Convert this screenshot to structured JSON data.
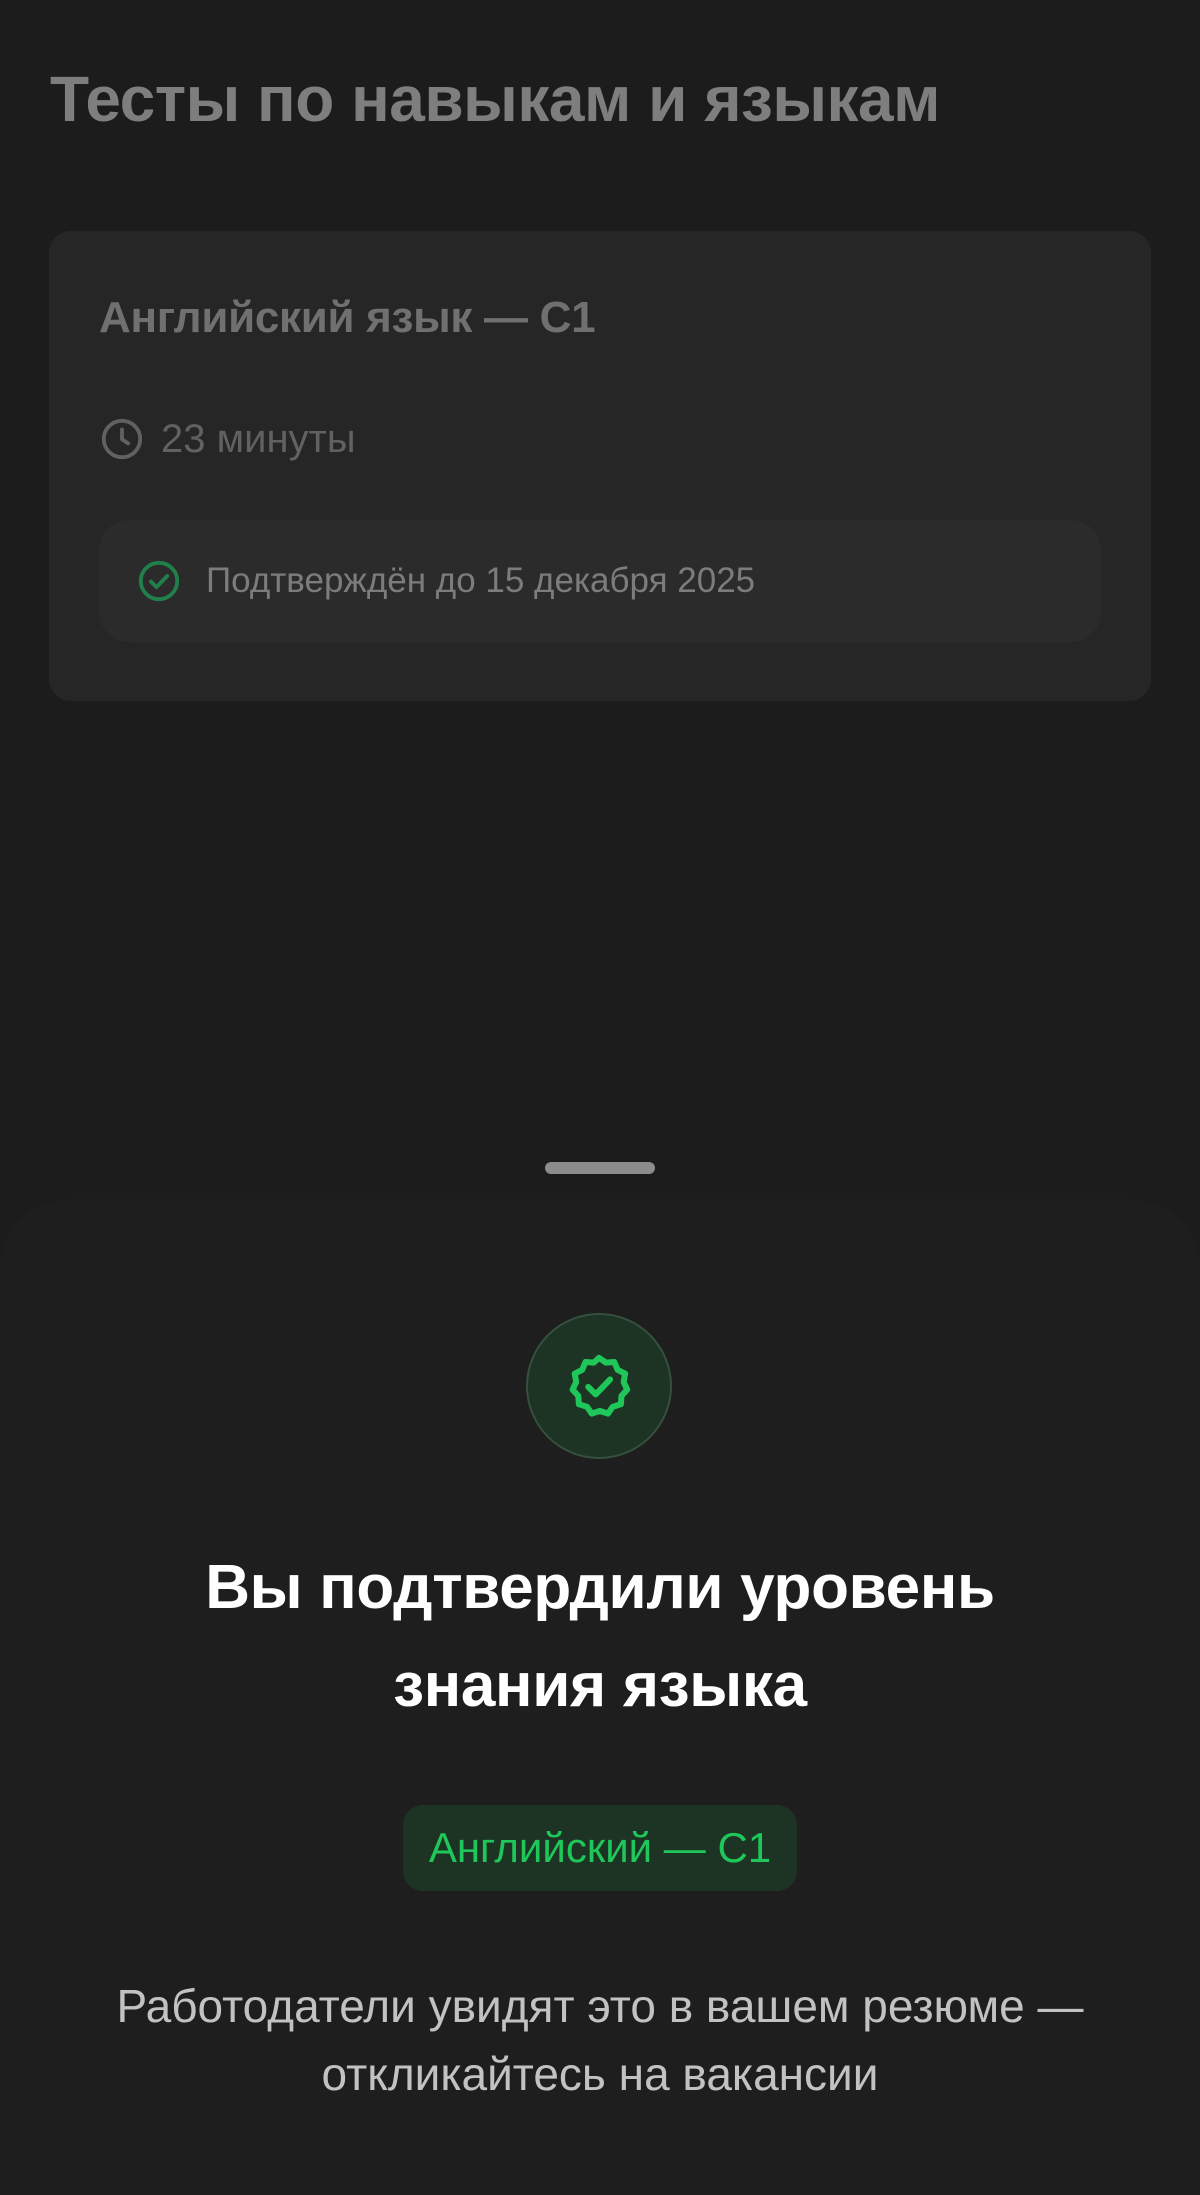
{
  "page": {
    "title": "Тесты по навыкам и языкам"
  },
  "test_card": {
    "title": "Английский язык — C1",
    "duration": "23 минуты",
    "duration_icon": "clock-icon",
    "verified_text": "Подтверждён до 15 декабря 2025",
    "verified_icon": "check-circle-icon"
  },
  "bottom_sheet": {
    "badge_icon": "verified-badge-icon",
    "title_line1": "Вы подтвердили уровень",
    "title_line2": "знания языка",
    "level_chip": "Английский — C1",
    "description_line1": "Работодатели увидят это в вашем резюме —",
    "description_line2": "откликайтесь на вакансии"
  },
  "colors": {
    "background": "#1c1c1c",
    "card": "#262626",
    "sheet": "#1e1e1e",
    "accent_green": "#1fc75a",
    "accent_green_bg": "#1d3324"
  }
}
